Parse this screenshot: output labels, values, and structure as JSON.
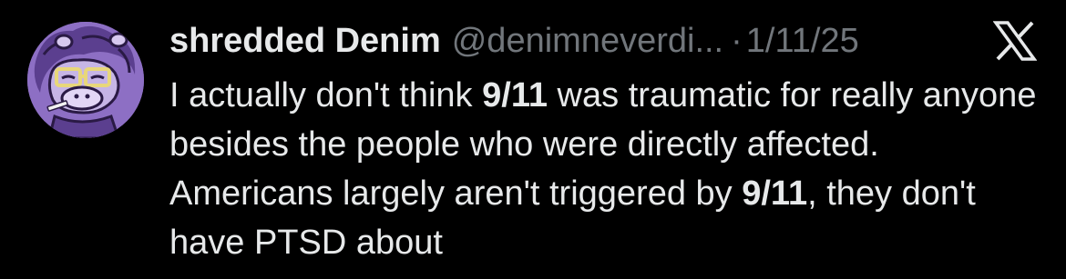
{
  "tweet": {
    "display_name": "shredded Denim",
    "handle": "@denimneverdi...",
    "separator": "·",
    "date": "1/11/25",
    "avatar_icon": "cartoon-character-avatar",
    "platform_icon": "x-logo-icon",
    "text_segments": [
      {
        "text": "I actually don't think ",
        "bold": false
      },
      {
        "text": "9/11",
        "bold": true
      },
      {
        "text": " was traumatic for really anyone besides the people who were directly affected. Americans largely aren't triggered by ",
        "bold": false
      },
      {
        "text": "9/11",
        "bold": true
      },
      {
        "text": ", they don't have PTSD about",
        "bold": false
      }
    ]
  },
  "colors": {
    "background": "#000000",
    "primary_text": "#e7e9ea",
    "secondary_text": "#71767b",
    "avatar_bg": "#8d6fc4"
  }
}
